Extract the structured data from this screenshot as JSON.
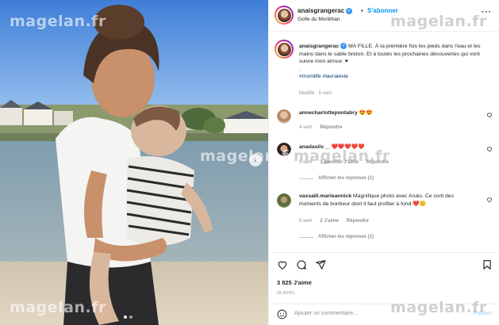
{
  "post": {
    "username": "anaisgrangerac",
    "separator": "•",
    "follow_label": "S'abonner",
    "location": "Golfe du Morbihan",
    "more_icon": "more-horizontal-icon",
    "caption": {
      "username": "anaisgrangerac",
      "text": "MA FILLE. À ta première fois les pieds dans l'eau et les mains dans le sable breton. Et à toutes les prochaines découvertes qui vont suivre mon amour. ♥",
      "dot": ".",
      "hashtags": "#momlife #lavraievie",
      "meta": "Modifié · 5 sem"
    },
    "comments": [
      {
        "username": "annecharlottepontabry",
        "text": "😍😍",
        "time": "4 sem",
        "reply_label": "Répondre",
        "mentions": ""
      },
      {
        "username": "anadasilv__",
        "text": "❤️❤️❤️❤️❤️",
        "time": "5 sem",
        "mentions": "1 mention J'aime",
        "reply_label": "Répondre",
        "view_replies": "Afficher les réponses (1)"
      },
      {
        "username": "vassalli.marieannick",
        "text": "Magnifique photo avec Anais. Ce sont des moments de bonheur dont il faut profiter à fond.❤️😊",
        "time": "5 sem",
        "mentions": "2 J'aime",
        "reply_label": "Répondre",
        "view_replies": "Afficher les réponses (1)"
      }
    ],
    "likes": "3 825 J'aime",
    "date": "20 AVRIL",
    "add_comment_placeholder": "Ajouter un commentaire...",
    "publish_label": "Publier",
    "watermarks": [
      "magelan.fr",
      "magelan.fr",
      "magelan.fr",
      "magelan.fr",
      "magelan.fr",
      "magelan.fr"
    ],
    "colors": {
      "link": "#0095f6",
      "hashtag": "#00376b",
      "muted": "#8e8e8e",
      "heart": "#ed4956"
    }
  }
}
